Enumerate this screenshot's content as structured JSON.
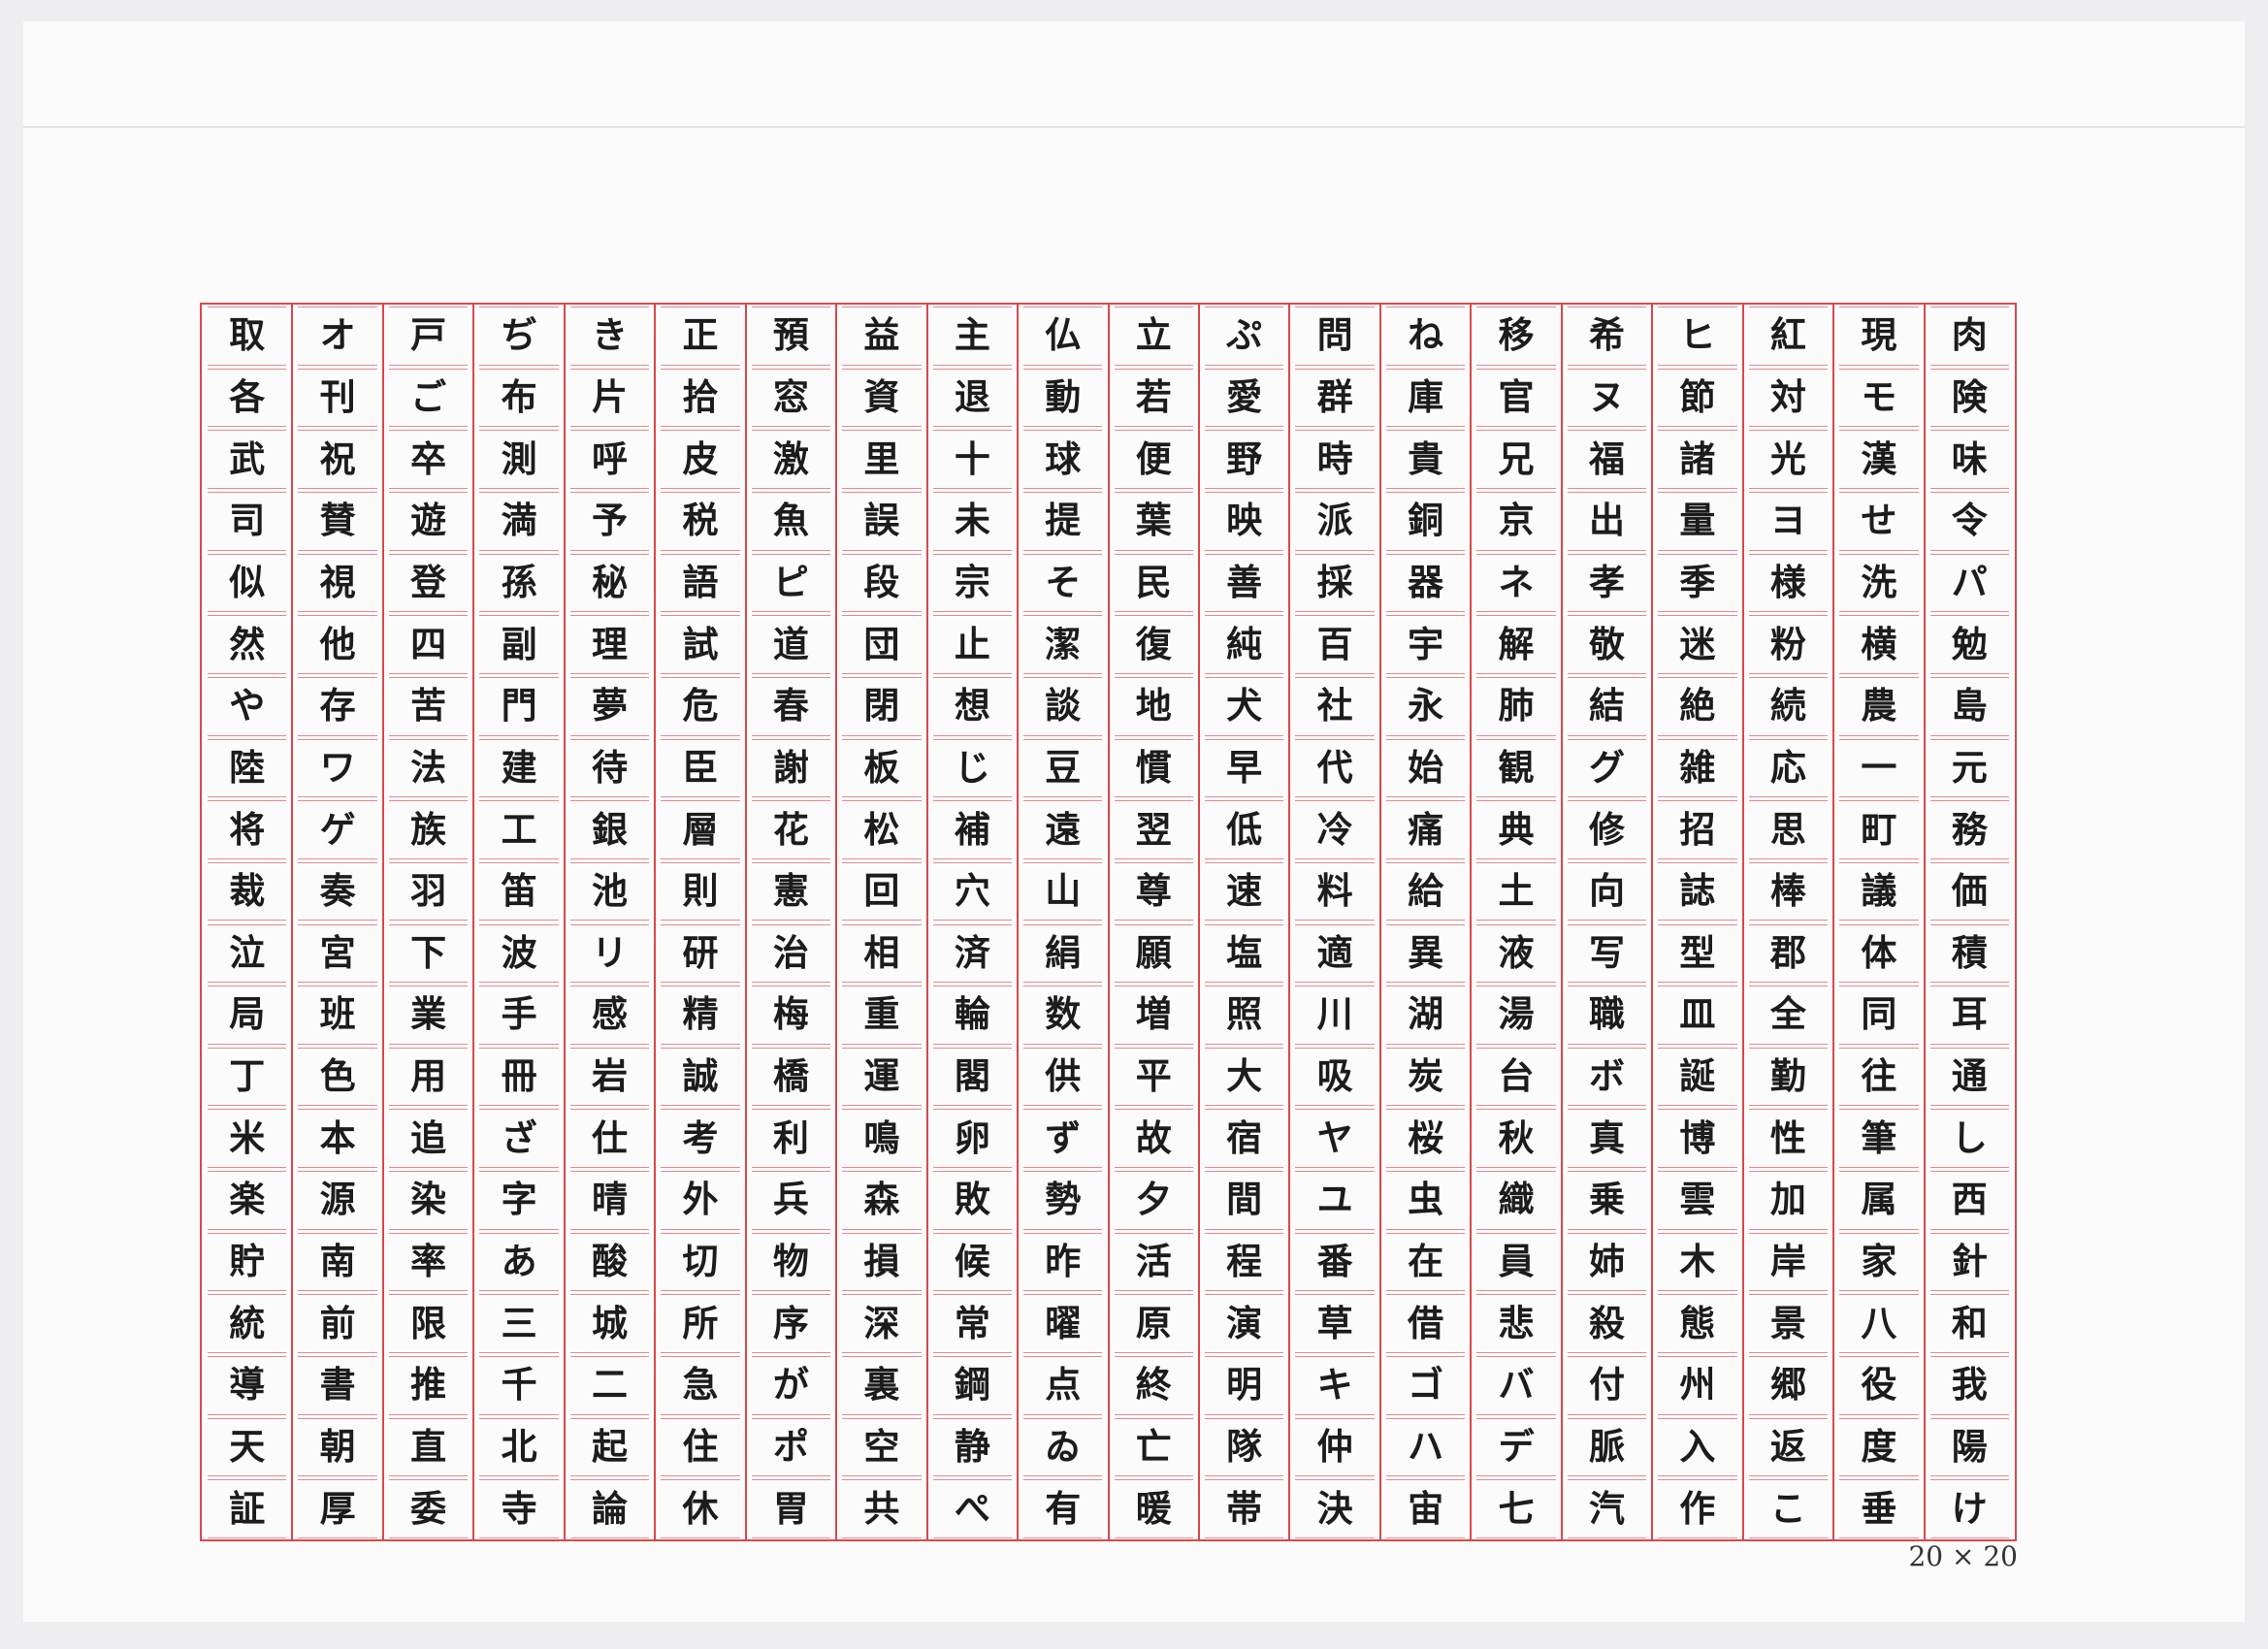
{
  "sheet": {
    "size_label": "20 × 20",
    "columns": [
      [
        "肉",
        "険",
        "味",
        "令",
        "パ",
        "勉",
        "島",
        "元",
        "務",
        "価",
        "積",
        "耳",
        "通",
        "し",
        "西",
        "針",
        "和",
        "我",
        "陽",
        "け"
      ],
      [
        "現",
        "モ",
        "漢",
        "せ",
        "洗",
        "横",
        "農",
        "一",
        "町",
        "議",
        "体",
        "同",
        "往",
        "筆",
        "属",
        "家",
        "八",
        "役",
        "度",
        "垂"
      ],
      [
        "紅",
        "対",
        "光",
        "ヨ",
        "様",
        "粉",
        "続",
        "応",
        "思",
        "棒",
        "郡",
        "全",
        "勤",
        "性",
        "加",
        "岸",
        "景",
        "郷",
        "返",
        "こ"
      ],
      [
        "ヒ",
        "節",
        "諸",
        "量",
        "季",
        "迷",
        "絶",
        "雑",
        "招",
        "誌",
        "型",
        "皿",
        "誕",
        "博",
        "雲",
        "木",
        "態",
        "州",
        "入",
        "作"
      ],
      [
        "希",
        "ヌ",
        "福",
        "出",
        "孝",
        "敬",
        "結",
        "グ",
        "修",
        "向",
        "写",
        "職",
        "ボ",
        "真",
        "乗",
        "姉",
        "殺",
        "付",
        "脈",
        "汽"
      ],
      [
        "移",
        "官",
        "兄",
        "京",
        "ネ",
        "解",
        "肺",
        "観",
        "典",
        "土",
        "液",
        "湯",
        "台",
        "秋",
        "織",
        "員",
        "悲",
        "バ",
        "デ",
        "七"
      ],
      [
        "ね",
        "庫",
        "貴",
        "銅",
        "器",
        "宇",
        "永",
        "始",
        "痛",
        "給",
        "異",
        "湖",
        "炭",
        "桜",
        "虫",
        "在",
        "借",
        "ゴ",
        "ハ",
        "宙"
      ],
      [
        "問",
        "群",
        "時",
        "派",
        "採",
        "百",
        "社",
        "代",
        "冷",
        "料",
        "適",
        "川",
        "吸",
        "ヤ",
        "ユ",
        "番",
        "草",
        "キ",
        "仲",
        "決"
      ],
      [
        "ぷ",
        "愛",
        "野",
        "映",
        "善",
        "純",
        "犬",
        "早",
        "低",
        "速",
        "塩",
        "照",
        "大",
        "宿",
        "間",
        "程",
        "演",
        "明",
        "隊",
        "帯"
      ],
      [
        "立",
        "若",
        "便",
        "葉",
        "民",
        "復",
        "地",
        "慣",
        "翌",
        "尊",
        "願",
        "増",
        "平",
        "故",
        "夕",
        "活",
        "原",
        "終",
        "亡",
        "暖"
      ],
      [
        "仏",
        "動",
        "球",
        "提",
        "そ",
        "潔",
        "談",
        "豆",
        "遠",
        "山",
        "絹",
        "数",
        "供",
        "ず",
        "勢",
        "昨",
        "曜",
        "点",
        "ゐ",
        "有"
      ],
      [
        "主",
        "退",
        "十",
        "未",
        "宗",
        "止",
        "想",
        "じ",
        "補",
        "穴",
        "済",
        "輪",
        "閣",
        "卵",
        "敗",
        "候",
        "常",
        "鋼",
        "静",
        "ぺ"
      ],
      [
        "益",
        "資",
        "里",
        "誤",
        "段",
        "団",
        "閉",
        "板",
        "松",
        "回",
        "相",
        "重",
        "運",
        "鳴",
        "森",
        "損",
        "深",
        "裏",
        "空",
        "共"
      ],
      [
        "預",
        "窓",
        "激",
        "魚",
        "ピ",
        "道",
        "春",
        "謝",
        "花",
        "憲",
        "治",
        "梅",
        "橋",
        "利",
        "兵",
        "物",
        "序",
        "が",
        "ポ",
        "胃"
      ],
      [
        "正",
        "拾",
        "皮",
        "税",
        "語",
        "試",
        "危",
        "臣",
        "層",
        "則",
        "研",
        "精",
        "誠",
        "考",
        "外",
        "切",
        "所",
        "急",
        "住",
        "休"
      ],
      [
        "き",
        "片",
        "呼",
        "予",
        "秘",
        "理",
        "夢",
        "待",
        "銀",
        "池",
        "リ",
        "感",
        "岩",
        "仕",
        "晴",
        "酸",
        "城",
        "二",
        "起",
        "論"
      ],
      [
        "ぢ",
        "布",
        "測",
        "満",
        "孫",
        "副",
        "門",
        "建",
        "工",
        "笛",
        "波",
        "手",
        "冊",
        "ざ",
        "字",
        "あ",
        "三",
        "千",
        "北",
        "寺"
      ],
      [
        "戸",
        "ご",
        "卒",
        "遊",
        "登",
        "四",
        "苦",
        "法",
        "族",
        "羽",
        "下",
        "業",
        "用",
        "追",
        "染",
        "率",
        "限",
        "推",
        "直",
        "委"
      ],
      [
        "オ",
        "刊",
        "祝",
        "賛",
        "視",
        "他",
        "存",
        "ワ",
        "ゲ",
        "奏",
        "宮",
        "班",
        "色",
        "本",
        "源",
        "南",
        "前",
        "書",
        "朝",
        "厚"
      ],
      [
        "取",
        "各",
        "武",
        "司",
        "似",
        "然",
        "や",
        "陸",
        "将",
        "裁",
        "泣",
        "局",
        "丁",
        "米",
        "楽",
        "貯",
        "統",
        "導",
        "天",
        "証"
      ]
    ]
  }
}
